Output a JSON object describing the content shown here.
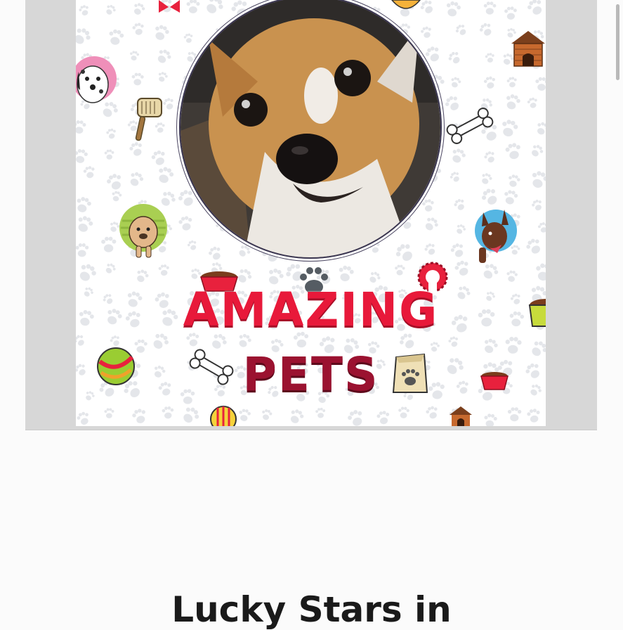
{
  "post": {
    "brand_line1": "AMAZING",
    "brand_line2": "PETS",
    "caption": "Lucky Stars in"
  },
  "colors": {
    "brand_red": "#e8193a",
    "brand_maroon": "#9b1230",
    "paw_gray": "#e4e6ea",
    "frame_gray": "#d7d7d7"
  },
  "icons": [
    "dog-photo",
    "dalmatian-icon",
    "pug-icon",
    "doberman-icon",
    "dog-house-icon",
    "bone-icon",
    "brush-icon",
    "food-bowl-icon",
    "ball-icon",
    "treat-bag-icon",
    "paw-icon",
    "bow-icon"
  ]
}
